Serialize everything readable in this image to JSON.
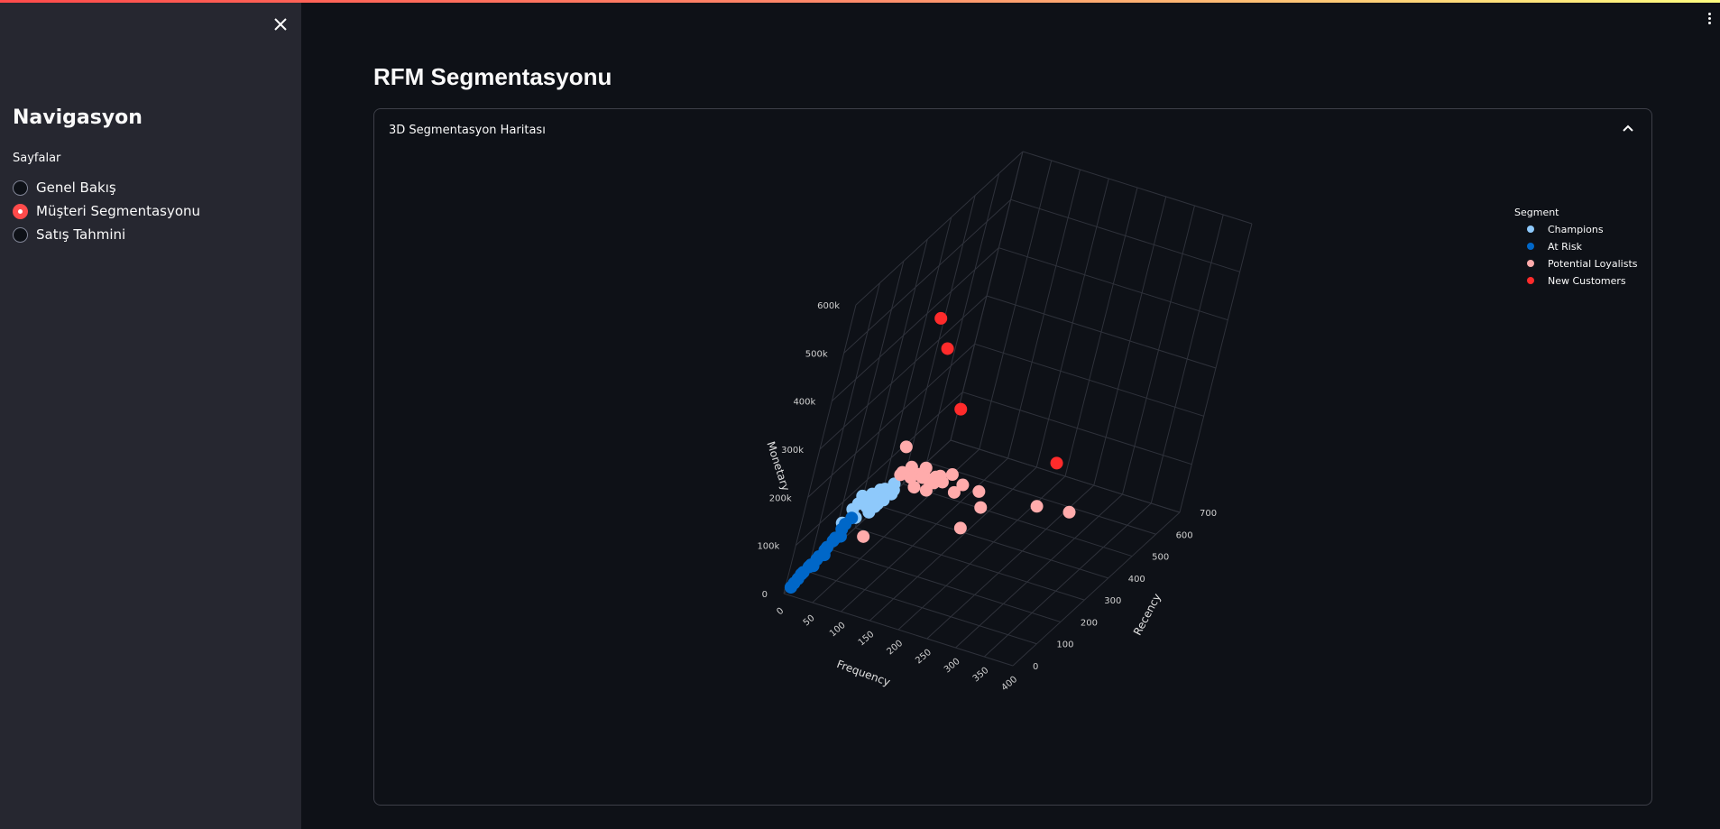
{
  "sidebar": {
    "title": "Navigasyon",
    "radio_label": "Sayfalar",
    "items": [
      {
        "label": "Genel Bakış",
        "selected": false
      },
      {
        "label": "Müşteri Segmentasyonu",
        "selected": true
      },
      {
        "label": "Satış Tahmini",
        "selected": false
      }
    ]
  },
  "main": {
    "title": "RFM Segmentasyonu",
    "expander_label": "3D Segmentasyon Haritası"
  },
  "colors": {
    "accent": "#ff4b4b",
    "champions": "#8ec9fb",
    "at_risk": "#0067c8",
    "potential_loyalists": "#ffabab",
    "new_customers": "#ff2b2b"
  },
  "chart_data": {
    "type": "scatter",
    "dimensions": "3d",
    "legend_title": "Segment",
    "legend": [
      "Champions",
      "At Risk",
      "Potential Loyalists",
      "New Customers"
    ],
    "axes": {
      "x": {
        "label": "Frequency",
        "ticks": [
          "0",
          "50",
          "100",
          "150",
          "200",
          "250",
          "300",
          "350",
          "400"
        ]
      },
      "y": {
        "label": "Recency",
        "ticks": [
          "0",
          "100",
          "200",
          "300",
          "400",
          "500",
          "600",
          "700"
        ]
      },
      "z": {
        "label": "Monetary",
        "ticks": [
          "0",
          "100k",
          "200k",
          "300k",
          "400k",
          "500k",
          "600k"
        ]
      }
    },
    "grid": true,
    "legend_position": "top-right",
    "series": [
      {
        "name": "Champions",
        "color": "#8ec9fb",
        "points": [
          [
            60,
            20,
            160000
          ],
          [
            70,
            25,
            190000
          ],
          [
            80,
            15,
            210000
          ],
          [
            85,
            10,
            230000
          ],
          [
            90,
            30,
            200000
          ],
          [
            95,
            20,
            220000
          ],
          [
            100,
            10,
            240000
          ],
          [
            105,
            35,
            210000
          ],
          [
            110,
            15,
            250000
          ],
          [
            115,
            25,
            230000
          ],
          [
            120,
            5,
            260000
          ],
          [
            125,
            30,
            240000
          ],
          [
            130,
            15,
            270000
          ],
          [
            90,
            50,
            180000
          ],
          [
            100,
            40,
            200000
          ],
          [
            75,
            35,
            170000
          ],
          [
            110,
            45,
            215000
          ],
          [
            130,
            20,
            255000
          ]
        ]
      },
      {
        "name": "At Risk",
        "color": "#0067c8",
        "points": [
          [
            3,
            20,
            5000
          ],
          [
            5,
            25,
            12000
          ],
          [
            8,
            30,
            20000
          ],
          [
            10,
            35,
            28000
          ],
          [
            14,
            30,
            36000
          ],
          [
            18,
            40,
            44000
          ],
          [
            22,
            35,
            52000
          ],
          [
            26,
            45,
            60000
          ],
          [
            30,
            40,
            70000
          ],
          [
            34,
            50,
            80000
          ],
          [
            38,
            45,
            90000
          ],
          [
            42,
            55,
            100000
          ],
          [
            46,
            50,
            110000
          ],
          [
            50,
            60,
            125000
          ],
          [
            55,
            55,
            140000
          ],
          [
            60,
            65,
            150000
          ],
          [
            48,
            70,
            105000
          ],
          [
            32,
            60,
            65000
          ],
          [
            20,
            55,
            40000
          ]
        ]
      },
      {
        "name": "Potential Loyalists",
        "color": "#ffabab",
        "points": [
          [
            130,
            30,
            340000
          ],
          [
            150,
            20,
            310000
          ],
          [
            160,
            40,
            290000
          ],
          [
            140,
            10,
            300000
          ],
          [
            170,
            50,
            280000
          ],
          [
            180,
            60,
            270000
          ],
          [
            190,
            30,
            300000
          ],
          [
            200,
            20,
            310000
          ],
          [
            175,
            15,
            320000
          ],
          [
            150,
            60,
            250000
          ],
          [
            165,
            80,
            240000
          ],
          [
            185,
            90,
            260000
          ],
          [
            210,
            120,
            250000
          ],
          [
            230,
            150,
            230000
          ],
          [
            260,
            80,
            240000
          ],
          [
            300,
            250,
            180000
          ],
          [
            340,
            300,
            160000
          ],
          [
            200,
            200,
            120000
          ],
          [
            70,
            120,
            90000
          ],
          [
            120,
            70,
            260000
          ],
          [
            145,
            45,
            275000
          ],
          [
            155,
            75,
            265000
          ],
          [
            195,
            100,
            275000
          ],
          [
            220,
            50,
            270000
          ]
        ]
      },
      {
        "name": "New Customers",
        "color": "#ff2b2b",
        "points": [
          [
            140,
            10,
            620000
          ],
          [
            160,
            20,
            560000
          ],
          [
            200,
            40,
            440000
          ],
          [
            380,
            30,
            400000
          ]
        ]
      }
    ]
  }
}
